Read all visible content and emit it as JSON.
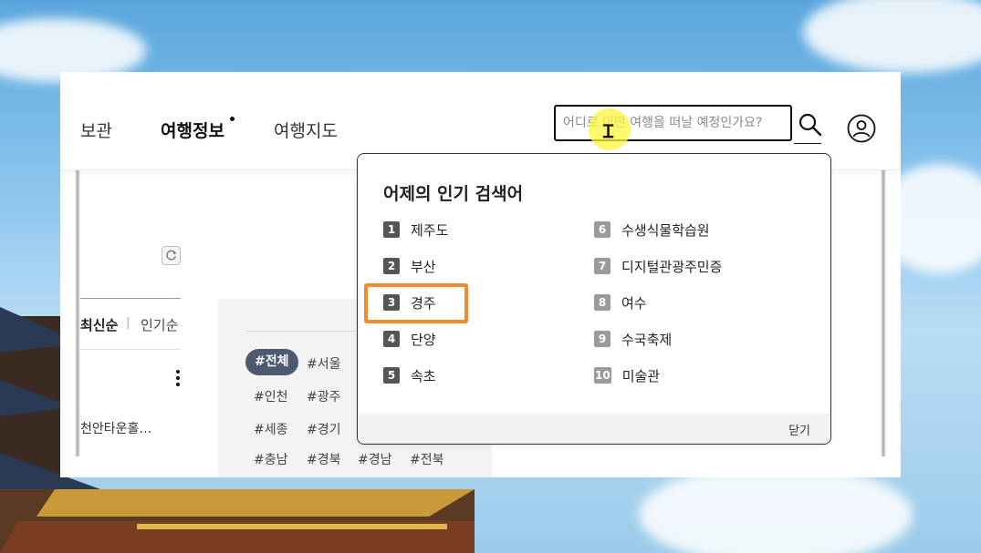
{
  "nav": {
    "items": [
      {
        "label": "보관",
        "bold": false
      },
      {
        "label": "여행정보",
        "bold": true
      },
      {
        "label": "여행지도",
        "bold": false
      }
    ]
  },
  "search": {
    "placeholder": "어디로 어떤 여행을 떠날 예정인가요?",
    "value": ""
  },
  "left": {
    "sort_latest": "최신순",
    "sort_separator": "|",
    "sort_popular": "인기순",
    "item_text": "천안타운홀…"
  },
  "tags": {
    "items": [
      "#전체",
      "#서울",
      "#인천",
      "#광주",
      "#세종",
      "#경기",
      "#충남",
      "#경북",
      "#경남",
      "#전북"
    ],
    "active_index": 0
  },
  "popular": {
    "title": "어제의 인기 검색어",
    "ranks": [
      {
        "num": "1",
        "text": "제주도"
      },
      {
        "num": "2",
        "text": "부산"
      },
      {
        "num": "3",
        "text": "경주"
      },
      {
        "num": "4",
        "text": "단양"
      },
      {
        "num": "5",
        "text": "속초"
      },
      {
        "num": "6",
        "text": "수생식물학습원"
      },
      {
        "num": "7",
        "text": "디지털관광주민증"
      },
      {
        "num": "8",
        "text": "여수"
      },
      {
        "num": "9",
        "text": "수국축제"
      },
      {
        "num": "10",
        "text": "미술관"
      }
    ],
    "close_label": "닫기",
    "highlighted_index": 2
  },
  "colors": {
    "highlight_border": "#f28b2c",
    "active_tag_bg": "#4b5a6e",
    "rank_dark": "#555555",
    "rank_light": "#9a9a9a"
  }
}
